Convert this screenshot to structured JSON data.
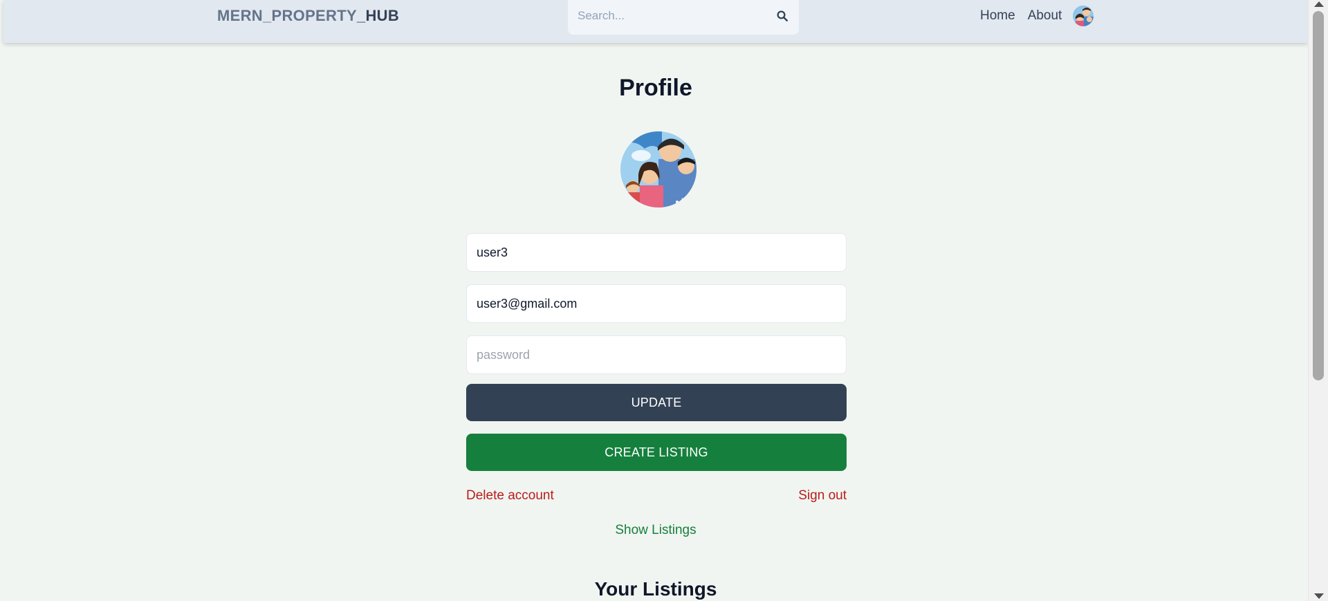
{
  "header": {
    "logo_part1": "MERN_PROPERTY",
    "logo_part2": "_HUB",
    "search_placeholder": "Search...",
    "nav": {
      "home": "Home",
      "about": "About"
    }
  },
  "profile": {
    "title": "Profile",
    "username_value": "user3",
    "email_value": "user3@gmail.com",
    "password_placeholder": "password",
    "update_label": "UPDATE",
    "create_listing_label": "CREATE LISTING",
    "delete_account_label": "Delete account",
    "sign_out_label": "Sign out",
    "show_listings_label": "Show Listings",
    "listings_heading": "Your Listings"
  },
  "colors": {
    "header_bg": "#e2e8f0",
    "page_bg": "#f1f5f1",
    "update_button": "#334155",
    "create_button": "#15803d",
    "danger_link": "#b91c1c",
    "success_link": "#15803d"
  },
  "icons": [
    "search-icon",
    "avatar"
  ]
}
